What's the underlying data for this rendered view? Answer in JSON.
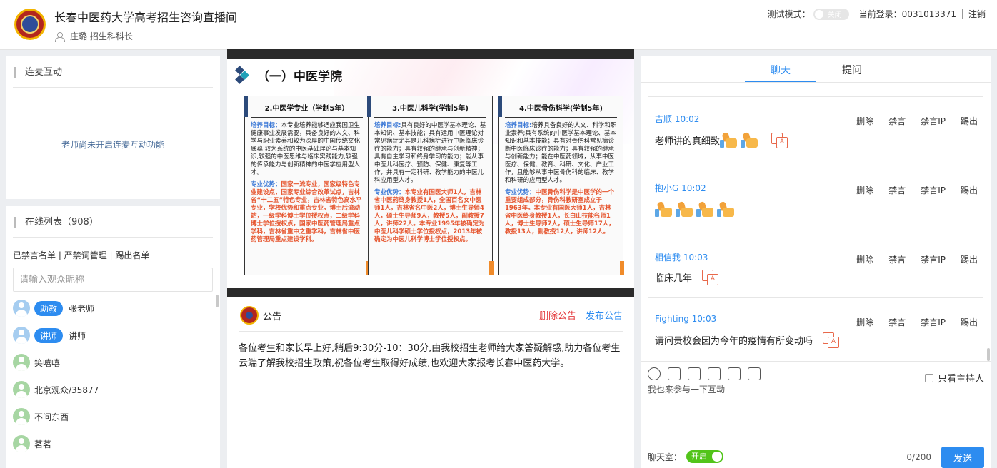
{
  "header": {
    "title": "长春中医药大学高考招生咨询直播间",
    "host": "庄璐 招生科科长",
    "test_mode_label": "测试模式：",
    "test_mode_toggle": "关闭",
    "current_login": "当前登录：0031013371",
    "logout": "注销"
  },
  "lianmai": {
    "title": "连麦互动",
    "empty": "老师尚未开启连麦互动功能"
  },
  "online": {
    "title": "在线列表（908）",
    "links": "已禁言名单 | 严禁词管理 | 踢出名单",
    "search_placeholder": "请输入观众昵称",
    "users": [
      {
        "role": "助教",
        "name": "张老师"
      },
      {
        "role": "讲师",
        "name": "讲师"
      },
      {
        "role": "",
        "name": "笑嘻嘻"
      },
      {
        "role": "",
        "name": "北京观众/35877"
      },
      {
        "role": "",
        "name": "不问东西"
      },
      {
        "role": "",
        "name": "茗茗"
      }
    ]
  },
  "slide": {
    "heading": "（一）中医学院",
    "cards": [
      {
        "title": "2.中医学专业（学制5年）",
        "goal_label": "培养目标：",
        "goal": "本专业培养能够适应我国卫生健康事业发展需要，具备良好的人文、科学与职业素养和较为深厚的中国传统文化底蕴,较为系统的中医基础理论与基本知识,较强的中医思维与临床实践能力,较强的传承能力与创新精神的中医学应用型人才。",
        "adv_label": "专业优势：",
        "adv": "国家一流专业，国家级特色专业建设点，国家专业综合改革试点，吉林省“十二五”特色专业，吉林省特色高水平专业，学校优势和重点专业。博士后流动站，一级学科博士学位授权点，二级学科博士学位授权点，国家中医药管理局重点学科，吉林省重中之重学科，吉林省中医药管理局重点建设学科。"
      },
      {
        "title": "3.中医儿科学(学制5年)",
        "goal_label": "培养目标:",
        "goal": "具有良好的中医学基本理论、基本知识、基本技能；具有运用中医理论对常见病症尤其是儿科病症进行中医临床诊疗的能力；具有较强的继承与创新精神；具有自主学习和终身学习的能力；能从事中医儿科医疗、预防、保健、康复等工作，并具有一定科研、教学能力的中医儿科应用型人才。",
        "adv_label": "专业优势：",
        "adv": "本专业有国医大师1人，吉林省中医药终身教授1人，全国百名女中医师1人，吉林省名中医2人，博士生导师4人，硕士生导师9人，教授5人，副教授7人，讲师22人。本专业1995年被确定为中医儿科学硕士学位授权点，2013年被确定为中医儿科学博士学位授权点。"
      },
      {
        "title": "4.中医骨伤科学(学制5年)",
        "goal_label": "培养目标:",
        "goal": "培养具备良好的人文、科学和职业素养;具有系统的中医学基本理论、基本知识和基本技能；具有对骨伤科常见病诊断中医临床诊疗的能力；具有较强的继承与创新能力；能在中医药领域，从事中医医疗、保健、教育、科研、文化、产业工作，且能够从事中医骨伤科的临床、教学和科研的应用型人才。",
        "adv_label": "专业优势：",
        "adv": "中医骨伤科学是中医学的一个重要组成部分，骨伤科教研室成立于1963年。本专业有国医大师1人，吉林省中医终身教授1人，长白山技能名师1人，博士生导师7人，硕士生导师17人，教授13人，副教授12人，讲师12人。"
      }
    ]
  },
  "notice": {
    "title": "公告",
    "delete": "删除公告",
    "publish": "发布公告",
    "body": "各位考生和家长早上好,稍后9:30分-10：30分,由我校招生老师给大家答疑解惑,助力各位考生云端了解我校招生政策,祝各位考生取得好成绩,也欢迎大家报考长春中医药大学。"
  },
  "chat": {
    "tabs": [
      "聊天",
      "提问"
    ],
    "actions": [
      "删除",
      "禁言",
      "禁言IP",
      "踢出"
    ],
    "messages": [
      {
        "who": "吉顺 10:02",
        "text": "老师讲的真细致",
        "thumbs": 2
      },
      {
        "who": "抱小G 10:02",
        "text": "",
        "thumbs": 4
      },
      {
        "who": "相信我 10:03",
        "text": "临床几年",
        "thumbs": 0
      },
      {
        "who": "Fighting 10:03",
        "text": "请问贵校会因为今年的疫情有所变动吗",
        "thumbs": 0
      }
    ],
    "only_host": "只看主持人",
    "input_placeholder": "我也来参与一下互动",
    "room_label": "聊天室：",
    "room_switch": "开启",
    "counter": "0/200",
    "send": "发送"
  },
  "colors": {
    "accent": "#2d8cf0",
    "danger": "#e4393c",
    "success": "#52c41a",
    "highlight": "#e6552e"
  }
}
